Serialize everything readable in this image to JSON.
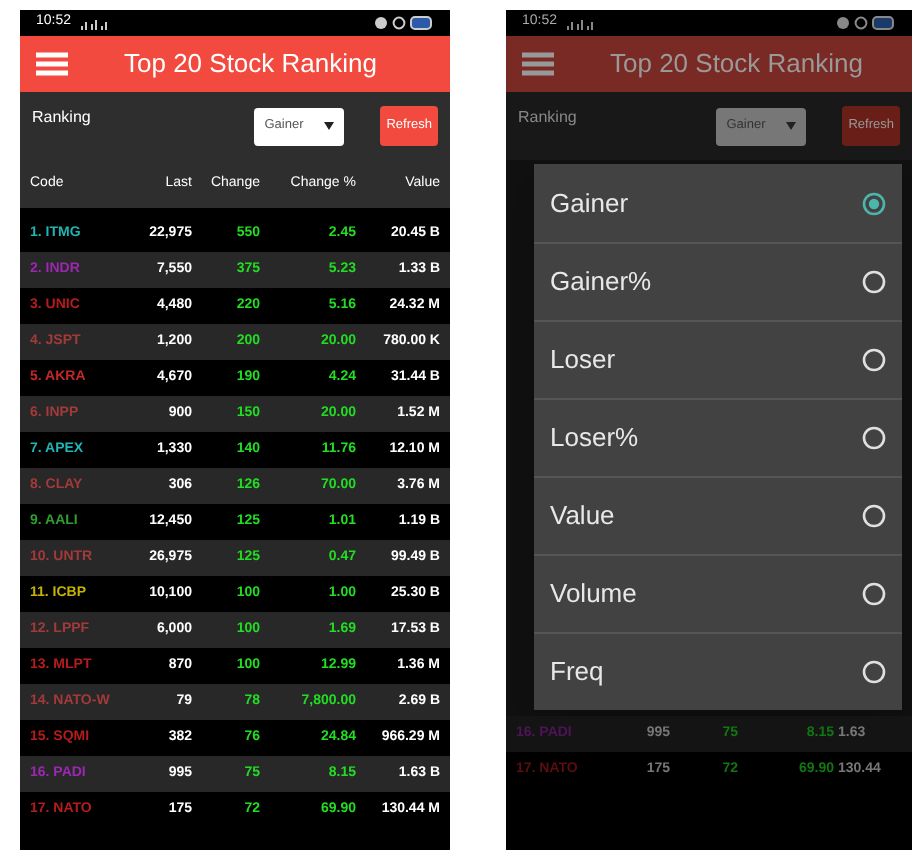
{
  "screens": [
    {
      "dimmed": false,
      "status_bar": {
        "time": "10:52"
      },
      "header": {
        "title": "Top 20 Stock Ranking"
      },
      "controls": {
        "label": "Ranking",
        "dropdown": "Gainer",
        "button": "Refresh"
      },
      "columns": [
        "Code",
        "Last",
        "Change",
        "Change %",
        "Value"
      ],
      "rows": [
        {
          "code": "1. ITMG",
          "color": "#1fb5b5",
          "last": "22,975",
          "change": "550",
          "change_pct": "2.45",
          "value": "20.45 B"
        },
        {
          "code": "2. INDR",
          "color": "#9c27b0",
          "last": "7,550",
          "change": "375",
          "change_pct": "5.23",
          "value": "1.33 B"
        },
        {
          "code": "3. UNIC",
          "color": "#b71c1c",
          "last": "4,480",
          "change": "220",
          "change_pct": "5.16",
          "value": "24.32 M"
        },
        {
          "code": "4. JSPT",
          "color": "#a33a3a",
          "last": "1,200",
          "change": "200",
          "change_pct": "20.00",
          "value": "780.00 K"
        },
        {
          "code": "5. AKRA",
          "color": "#c62828",
          "last": "4,670",
          "change": "190",
          "change_pct": "4.24",
          "value": "31.44 B"
        },
        {
          "code": "6. INPP",
          "color": "#a33a3a",
          "last": "900",
          "change": "150",
          "change_pct": "20.00",
          "value": "1.52 M"
        },
        {
          "code": "7. APEX",
          "color": "#1fb5b5",
          "last": "1,330",
          "change": "140",
          "change_pct": "11.76",
          "value": "12.10 M"
        },
        {
          "code": "8. CLAY",
          "color": "#a33a3a",
          "last": "306",
          "change": "126",
          "change_pct": "70.00",
          "value": "3.76 M"
        },
        {
          "code": "9. AALI",
          "color": "#2e9e2e",
          "last": "12,450",
          "change": "125",
          "change_pct": "1.01",
          "value": "1.19 B"
        },
        {
          "code": "10. UNTR",
          "color": "#a33a3a",
          "last": "26,975",
          "change": "125",
          "change_pct": "0.47",
          "value": "99.49 B"
        },
        {
          "code": "11. ICBP",
          "color": "#c8b400",
          "last": "10,100",
          "change": "100",
          "change_pct": "1.00",
          "value": "25.30 B"
        },
        {
          "code": "12. LPPF",
          "color": "#a33a3a",
          "last": "6,000",
          "change": "100",
          "change_pct": "1.69",
          "value": "17.53 B"
        },
        {
          "code": "13. MLPT",
          "color": "#b71c1c",
          "last": "870",
          "change": "100",
          "change_pct": "12.99",
          "value": "1.36 M"
        },
        {
          "code": "14. NATO-W",
          "color": "#a33a3a",
          "last": "79",
          "change": "78",
          "change_pct": "7,800.00",
          "value": "2.69 B"
        },
        {
          "code": "15. SQMI",
          "color": "#b71c1c",
          "last": "382",
          "change": "76",
          "change_pct": "24.84",
          "value": "966.29 M"
        },
        {
          "code": "16. PADI",
          "color": "#9c27b0",
          "last": "995",
          "change": "75",
          "change_pct": "8.15",
          "value": "1.63 B"
        },
        {
          "code": "17. NATO",
          "color": "#b71c1c",
          "last": "175",
          "change": "72",
          "change_pct": "69.90",
          "value": "130.44 M"
        }
      ]
    },
    {
      "dimmed": true,
      "status_bar": {
        "time": "10:52"
      },
      "header": {
        "title": "Top 20 Stock Ranking"
      },
      "controls": {
        "label": "Ranking",
        "dropdown": "Gainer",
        "button": "Refresh"
      },
      "dialog": {
        "options": [
          {
            "label": "Gainer",
            "selected": true
          },
          {
            "label": "Gainer%",
            "selected": false
          },
          {
            "label": "Loser",
            "selected": false
          },
          {
            "label": "Loser%",
            "selected": false
          },
          {
            "label": "Value",
            "selected": false
          },
          {
            "label": "Volume",
            "selected": false
          },
          {
            "label": "Freq",
            "selected": false
          }
        ]
      },
      "rows": [
        {
          "code": "16. PADI",
          "color": "#4e1458",
          "last": "995",
          "change": "75",
          "change_pct": "8.15",
          "value": "1.63"
        },
        {
          "code": "17. NATO",
          "color": "#5c0e0e",
          "last": "175",
          "change": "72",
          "change_pct": "69.90",
          "value": "130.44"
        }
      ]
    }
  ]
}
